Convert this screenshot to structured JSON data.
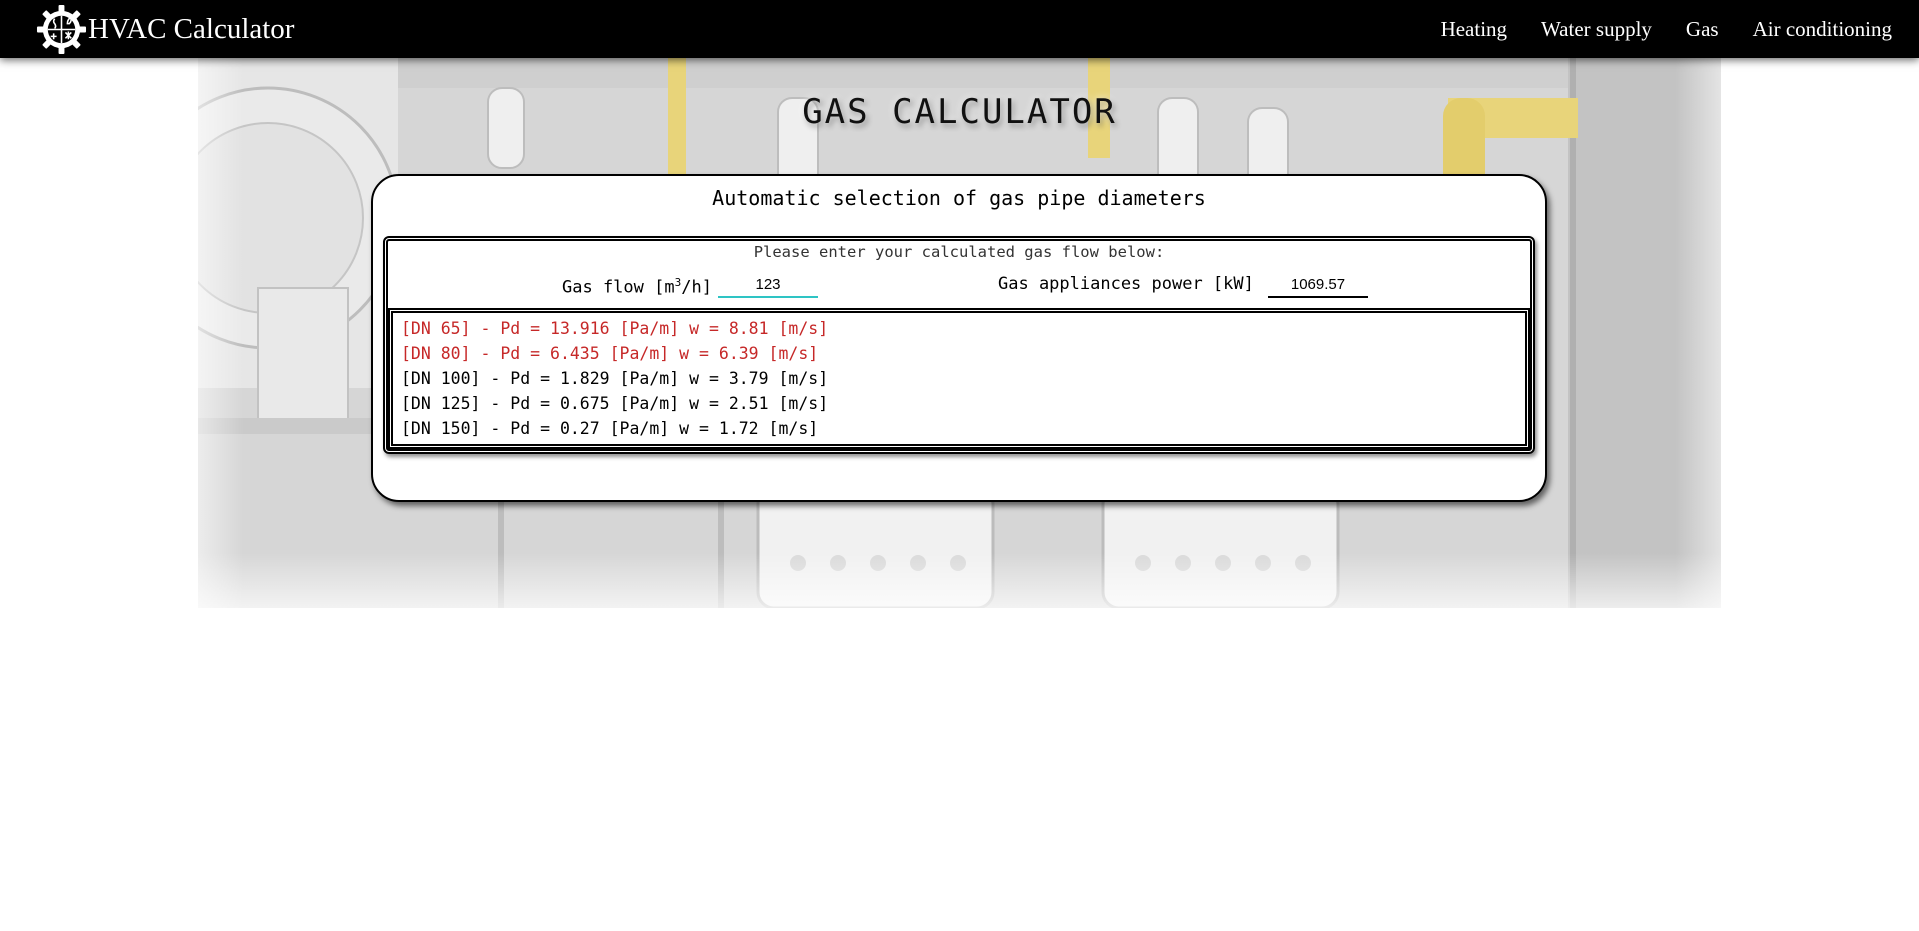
{
  "brand": {
    "name": "HVAC Calculator",
    "logo_icon": "gear-logo-icon"
  },
  "nav": {
    "items": [
      {
        "label": "Heating"
      },
      {
        "label": "Water supply"
      },
      {
        "label": "Gas"
      },
      {
        "label": "Air conditioning"
      }
    ]
  },
  "page": {
    "title": "GAS CALCULATOR"
  },
  "calculator": {
    "title": "Automatic selection of gas pipe diameters",
    "prompt": "Please enter your calculated gas flow below:",
    "gas_flow": {
      "label_prefix": "Gas flow [m",
      "label_sup": "3",
      "label_suffix": "/h]",
      "value": "123"
    },
    "power": {
      "label": "Gas appliances power [kW]",
      "value": "1069.57"
    },
    "results": [
      {
        "text": "[DN 65] - Pd = 13.916 [Pa/m] w = 8.81 [m/s]",
        "status": "exceeded",
        "color": "#c62828"
      },
      {
        "text": "[DN 80] - Pd = 6.435 [Pa/m] w = 6.39 [m/s]",
        "status": "exceeded",
        "color": "#c62828"
      },
      {
        "text": "[DN 100] - Pd = 1.829 [Pa/m] w = 3.79 [m/s]",
        "status": "ok",
        "color": "#000000"
      },
      {
        "text": "[DN 125] - Pd = 0.675 [Pa/m] w = 2.51 [m/s]",
        "status": "ok",
        "color": "#000000"
      },
      {
        "text": "[DN 150] - Pd = 0.27 [Pa/m] w = 1.72 [m/s]",
        "status": "ok",
        "color": "#000000"
      }
    ]
  },
  "colors": {
    "navbar": "#000000",
    "error": "#c62828",
    "focus_underline": "#2ec4c4"
  }
}
